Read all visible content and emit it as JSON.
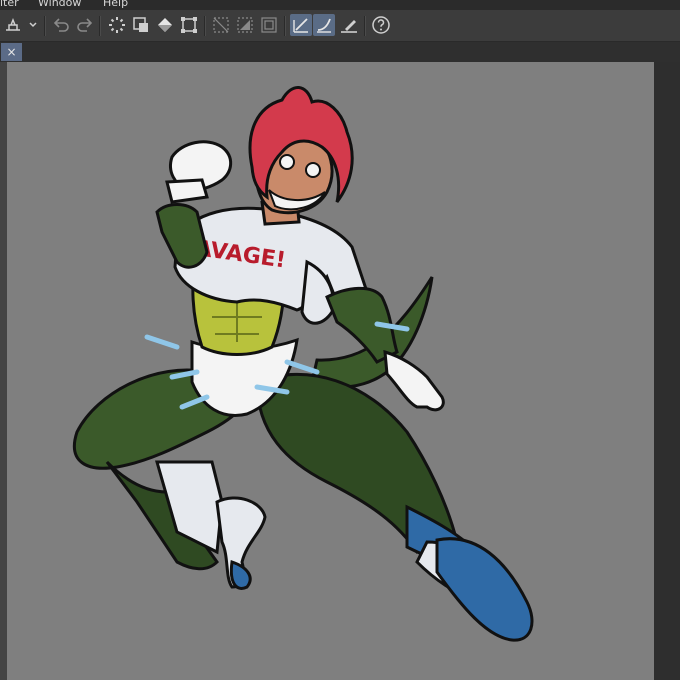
{
  "menubar": {
    "items": [
      "iter",
      "Window",
      "Help"
    ]
  },
  "toolbar": {
    "buttons": [
      "layer-dropdown",
      "undo",
      "redo",
      "loading",
      "clear",
      "fill",
      "transform",
      "hide-selection",
      "select-all",
      "deselect",
      "draw-line-tool",
      "curve-tool",
      "ruler-tool",
      "help"
    ]
  },
  "tab": {
    "close_label": "×"
  },
  "artwork": {
    "shirt_text": "SAVAGE!"
  },
  "colors": {
    "hair": "#d33a4c",
    "skin": "#c98a6a",
    "suit_green": "#3b5a2a",
    "scales_yellow": "#b8c23c",
    "shirt": "#e6e9ee",
    "boots": "#2f6aa6",
    "accent_blue": "#8fc6e8",
    "canvas_gray": "#7f7f7f"
  }
}
